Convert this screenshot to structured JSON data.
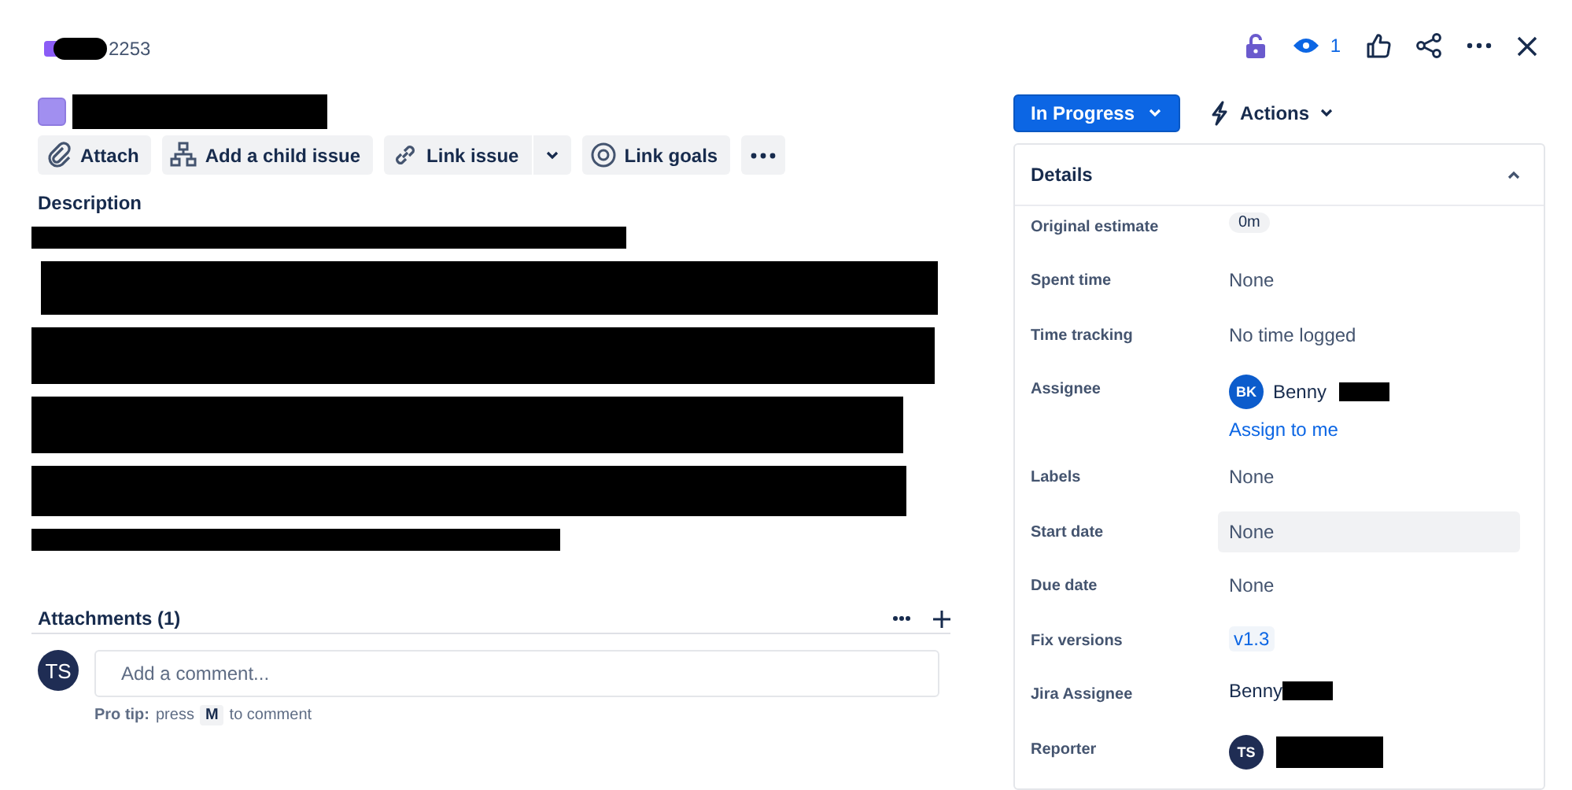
{
  "header": {
    "issue_key": "2253",
    "watchers": "1"
  },
  "toolbar": [
    {
      "label": "Attach"
    },
    {
      "label": "Add a child issue"
    },
    {
      "label": "Link issue",
      "split": true
    },
    {
      "label": "Link goals"
    }
  ],
  "description": {
    "heading": "Description"
  },
  "attachments": {
    "heading": "Attachments (1)"
  },
  "comment": {
    "avatar": "TS",
    "placeholder": "Add a comment...",
    "tip_label": "Pro tip:",
    "tip_before": "press",
    "tip_key": "M",
    "tip_after": "to comment"
  },
  "status": {
    "label": "In Progress"
  },
  "actions": {
    "label": "Actions"
  },
  "details": {
    "title": "Details",
    "expanded": true,
    "fields": [
      {
        "label": "Original estimate",
        "kind": "badge",
        "value": "0m"
      },
      {
        "label": "Spent time",
        "kind": "plain",
        "value": "None"
      },
      {
        "label": "Time tracking",
        "kind": "plain",
        "value": "No time logged"
      },
      {
        "label": "Assignee",
        "kind": "user",
        "avatar": "BK",
        "value": "Benny",
        "link": "Assign to me"
      },
      {
        "label": "Labels",
        "kind": "plain",
        "value": "None"
      },
      {
        "label": "Start date",
        "kind": "hover",
        "value": "None"
      },
      {
        "label": "Due date",
        "kind": "plain",
        "value": "None"
      },
      {
        "label": "Fix versions",
        "kind": "version",
        "value": "v1.3"
      },
      {
        "label": "Jira Assignee",
        "kind": "name",
        "value": "Benny"
      },
      {
        "label": "Reporter",
        "kind": "user",
        "avatar": "TS"
      }
    ]
  }
}
